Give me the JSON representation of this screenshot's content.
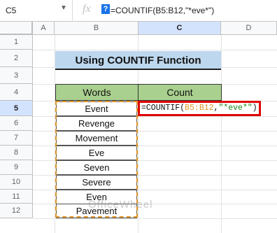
{
  "namebox": {
    "value": "C5"
  },
  "formula_bar": {
    "fx_label": "fx",
    "help_badge": "?",
    "formula": "=COUNTIF(B5:B12,\"*eve*\")"
  },
  "columns": [
    "A",
    "B",
    "C",
    "D"
  ],
  "rows": [
    "1",
    "2",
    "3",
    "4",
    "5",
    "6",
    "7",
    "8",
    "9",
    "10",
    "11",
    "12"
  ],
  "title": "Using COUNTIF Function",
  "table": {
    "headers": [
      "Words",
      "Count"
    ],
    "words": [
      "Event",
      "Revenge",
      "Movement",
      "Eve",
      "Seven",
      "Severe",
      "Even",
      "Pavement"
    ]
  },
  "active_cell": {
    "prefix": "=COUNTIF(",
    "range": "B5:B12",
    "sep": ",",
    "criteria": "\"*eve*\"",
    "suffix": ")"
  },
  "watermark": "OfficeWheel",
  "colors": {
    "title_bg": "#bdd7ee",
    "header_bg": "#a9d08e",
    "selection_border": "#e00000",
    "range_dash": "#e0952a"
  }
}
